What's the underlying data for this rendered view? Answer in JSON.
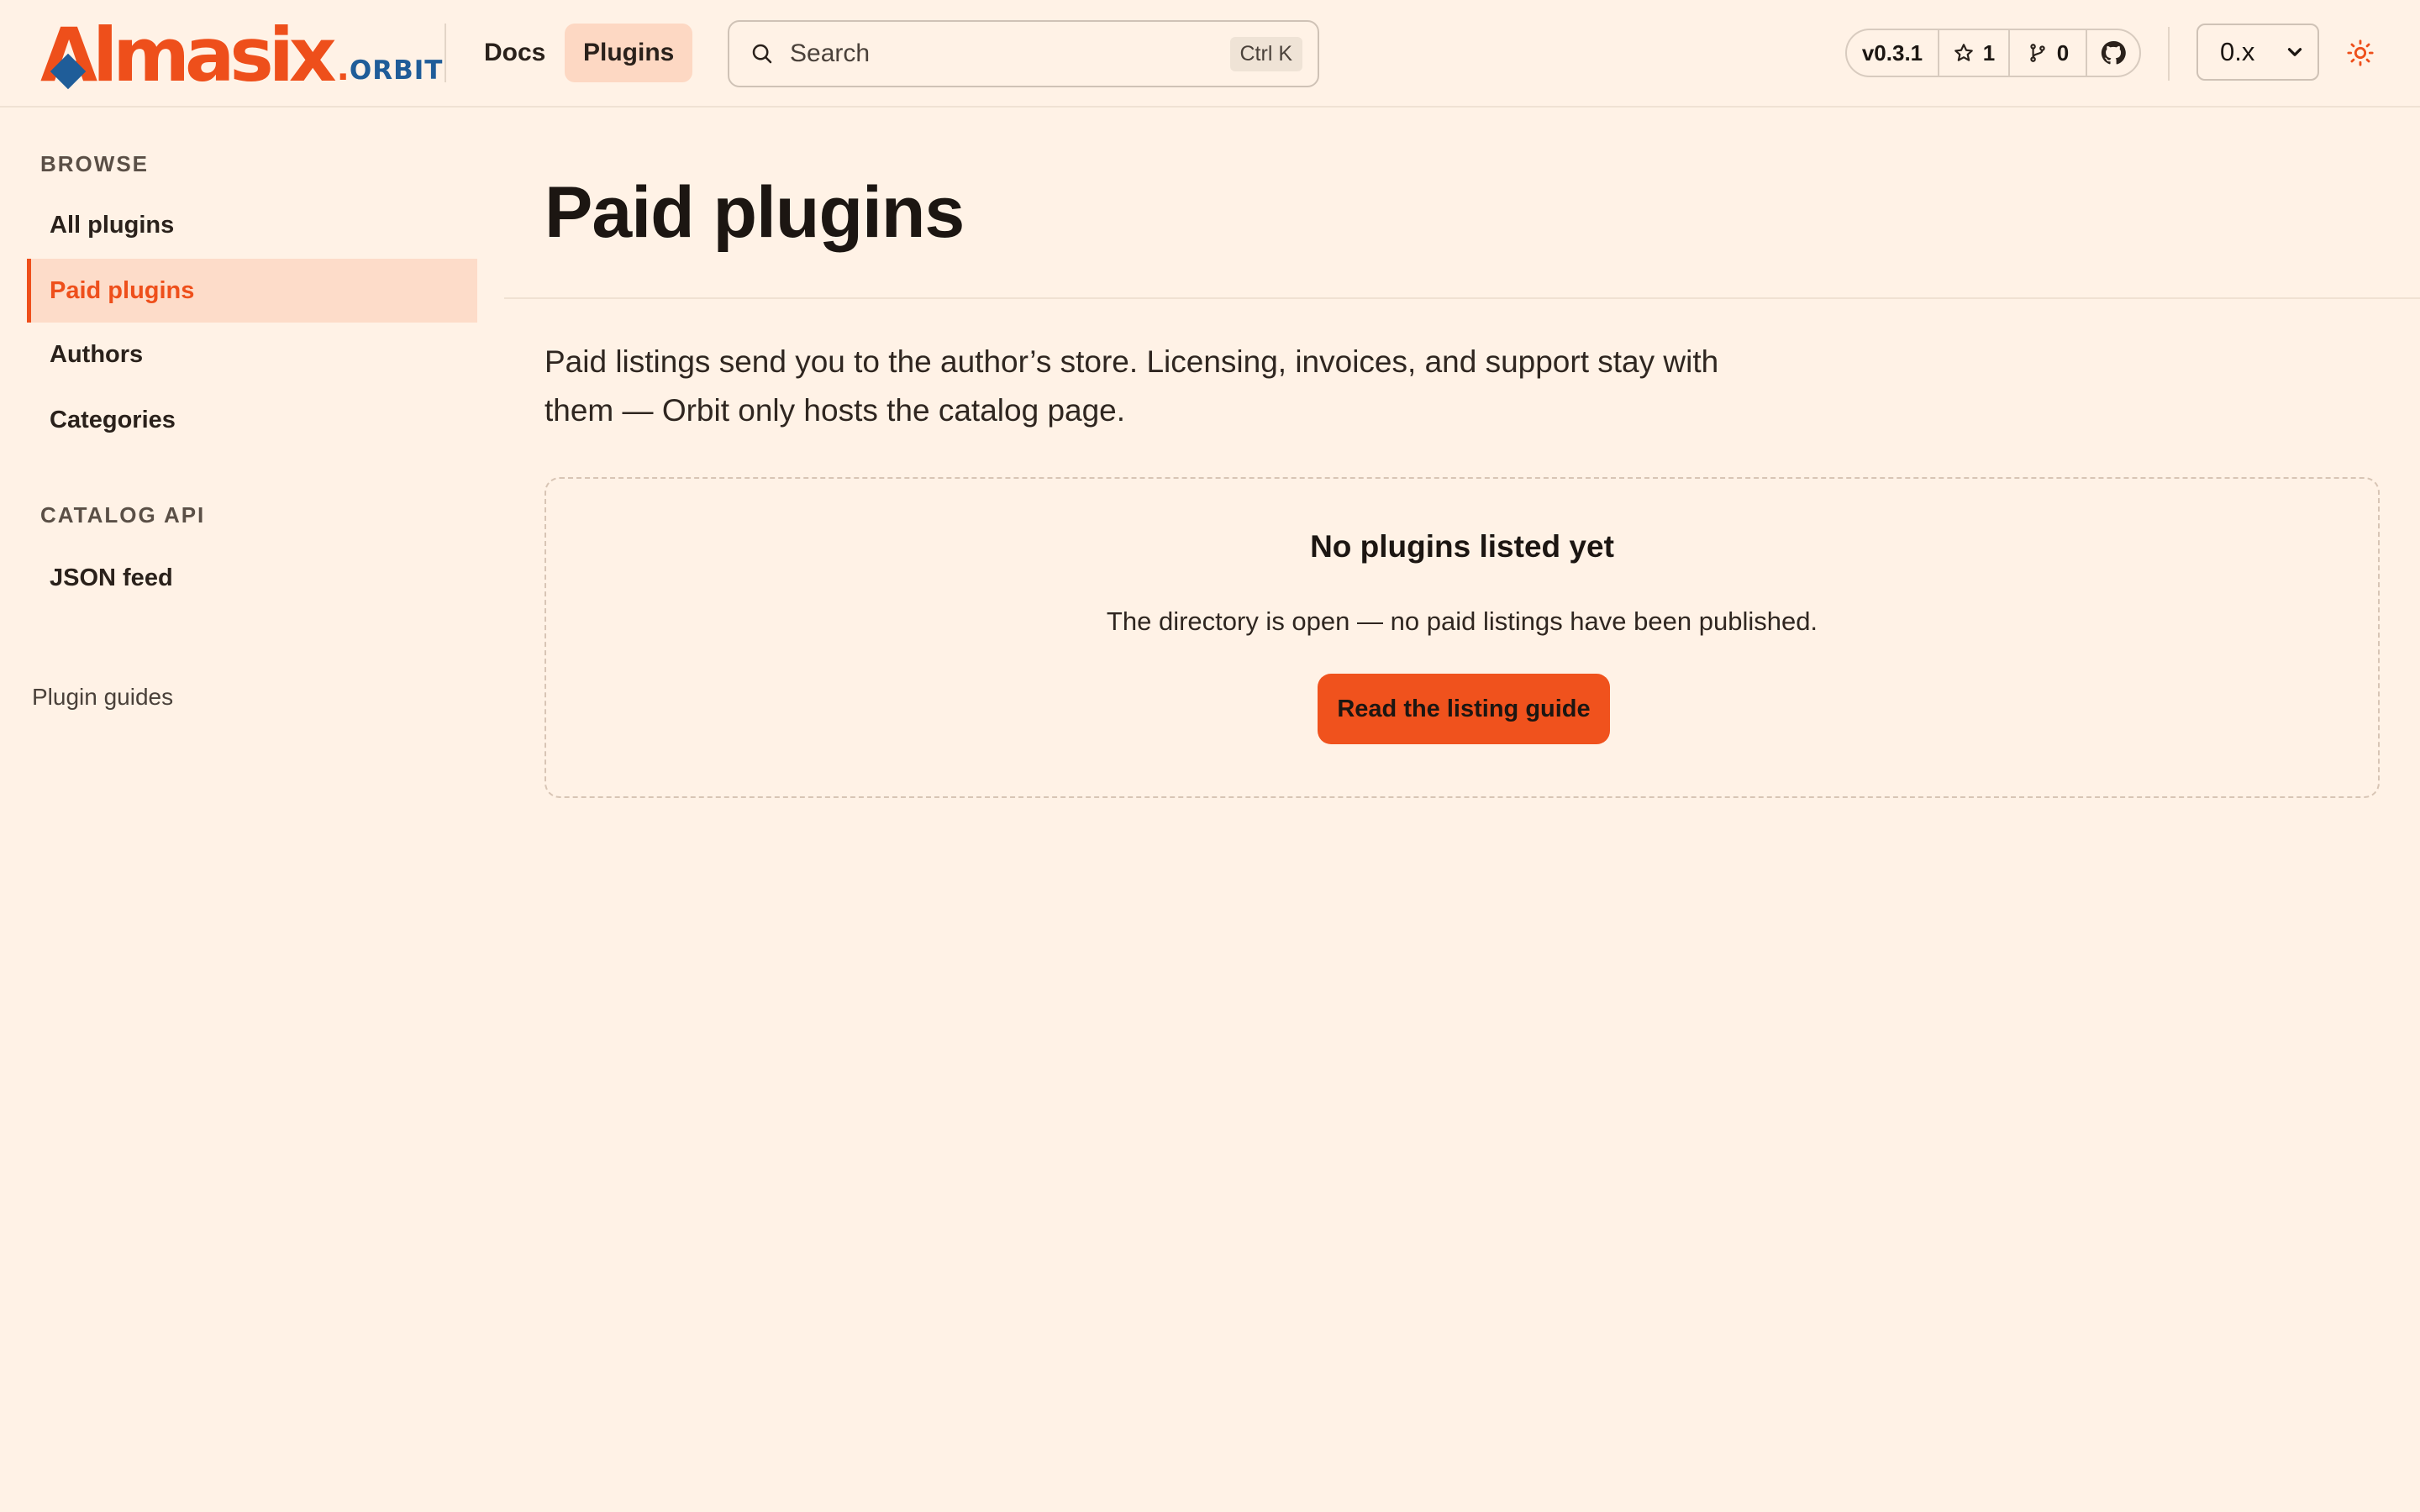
{
  "brand": {
    "name": "Almasix",
    "dot": ".",
    "product": "ORBIT"
  },
  "nav": {
    "docs": "Docs",
    "plugins": "Plugins"
  },
  "search": {
    "placeholder": "Search",
    "shortcut": "Ctrl K"
  },
  "repo": {
    "version": "v0.3.1",
    "stars": "1",
    "forks": "0"
  },
  "version_select": {
    "selected": "0.x"
  },
  "sidebar": {
    "sections": [
      {
        "heading": "BROWSE",
        "items": [
          {
            "label": "All plugins"
          },
          {
            "label": "Paid plugins",
            "active": true
          },
          {
            "label": "Authors"
          },
          {
            "label": "Categories"
          }
        ]
      },
      {
        "heading": "CATALOG API",
        "items": [
          {
            "label": "JSON feed"
          }
        ]
      }
    ],
    "footer_link": "Plugin guides"
  },
  "main": {
    "title": "Paid plugins",
    "lead_line1": "Paid listings send you to the author’s store. Licensing, invoices, and support stay with",
    "lead_line2": "them — Orbit only hosts the catalog page.",
    "empty_state": {
      "title": "No plugins listed yet",
      "text": "The directory is open — no paid listings have been published.",
      "cta": "Read the listing guide"
    }
  },
  "colors": {
    "background": "#fff2e6",
    "accent": "#ee4f1b",
    "brand_blue": "#1f5d99",
    "active_bg": "#fddcc9"
  }
}
